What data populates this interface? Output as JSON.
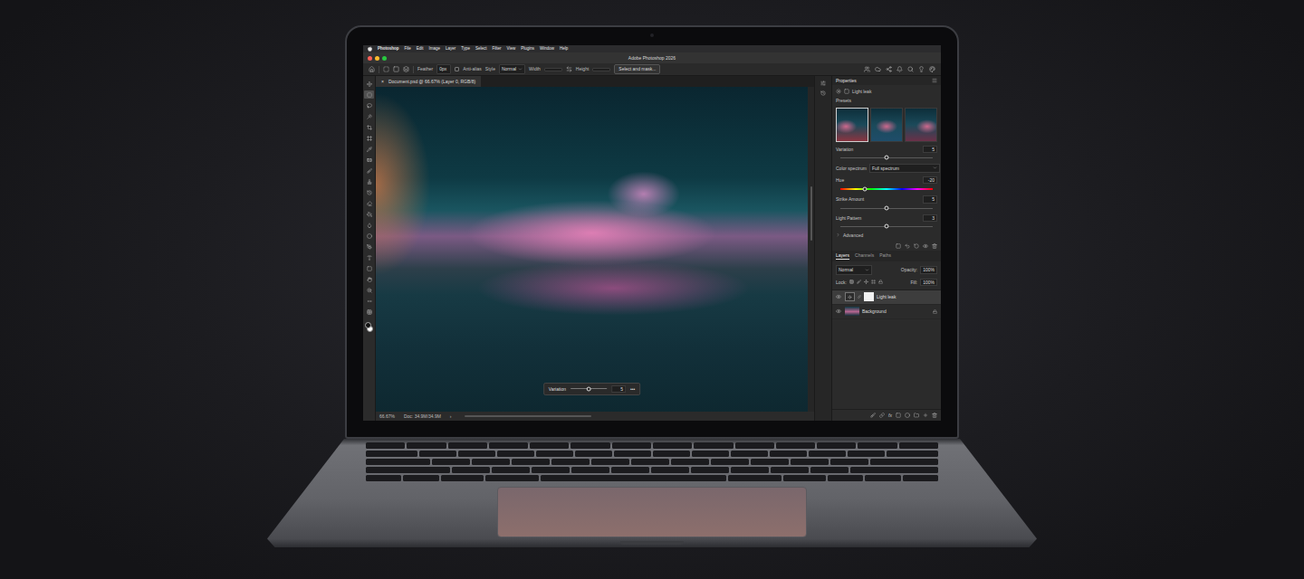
{
  "menu": [
    "Photoshop",
    "File",
    "Edit",
    "Image",
    "Layer",
    "Type",
    "Select",
    "Filter",
    "View",
    "Plugins",
    "Window",
    "Help"
  ],
  "window": {
    "title": "Adobe Photoshop 2026"
  },
  "options_bar": {
    "feather_label": "Feather",
    "feather_value": "0px",
    "anti_alias_label": "Anti-alias",
    "anti_alias_checked": false,
    "style_label": "Style",
    "style_value": "Normal",
    "width_label": "Width",
    "height_label": "Height",
    "select_mask": "Select and mask..."
  },
  "document_tab": {
    "close": "×",
    "title": "Document.psd @ 66.67% (Layer 0, RGB/8)"
  },
  "tools": [
    {
      "selected": false
    },
    {
      "selected": true
    },
    {
      "selected": false
    },
    {
      "selected": false
    },
    {
      "selected": false
    },
    {
      "selected": false
    },
    {
      "selected": false
    },
    {
      "selected": false
    },
    {
      "selected": false
    },
    {
      "selected": false
    },
    {
      "selected": false
    },
    {
      "selected": false
    },
    {
      "selected": false
    },
    {
      "selected": false
    },
    {
      "selected": false
    },
    {
      "selected": false
    },
    {
      "selected": false
    },
    {
      "selected": false
    },
    {
      "selected": false
    },
    {
      "selected": false
    },
    {
      "selected": false
    },
    {
      "selected": false
    }
  ],
  "floating_bar": {
    "label": "Variation",
    "level": 0.5,
    "value": "5",
    "more": "•••"
  },
  "status_bar": {
    "zoom": "66.67%",
    "doc": "Doc: 34.9M/34.9M",
    "arrow": "›"
  },
  "properties": {
    "title": "Properties",
    "layer_name": "Light leak",
    "presets_label": "Presets",
    "presets": [
      {
        "selected": true
      },
      {
        "selected": false
      },
      {
        "selected": false
      }
    ],
    "controls": [
      {
        "kind": "slider",
        "label": "Variation",
        "value": "5",
        "level": 0.5
      },
      {
        "kind": "dropdown",
        "label": "Color spectrum",
        "value": "Full spectrum"
      },
      {
        "kind": "hue",
        "label": "Hue",
        "value": "-20",
        "level": 0.26
      },
      {
        "kind": "slider",
        "label": "Strike Amount",
        "value": "5",
        "level": 0.5
      },
      {
        "kind": "slider",
        "label": "Light Pattern",
        "value": "3",
        "level": 0.5
      }
    ],
    "advanced": {
      "label": "Advanced",
      "expanded": false
    }
  },
  "layers_panel": {
    "tabs": [
      {
        "label": "Layers",
        "selected": true
      },
      {
        "label": "Channels",
        "selected": false
      },
      {
        "label": "Paths",
        "selected": false
      }
    ],
    "blend_mode": "Normal",
    "opacity_label": "Opacity:",
    "opacity": "100%",
    "lock_label": "Lock:",
    "fill_label": "Fill:",
    "fill": "100%",
    "layers": [
      {
        "name": "Light leak",
        "kind": "adjustment",
        "visible": true,
        "selected": true,
        "locked": false
      },
      {
        "name": "Background",
        "kind": "image",
        "visible": true,
        "selected": false,
        "locked": true
      }
    ],
    "fx": "fx"
  }
}
